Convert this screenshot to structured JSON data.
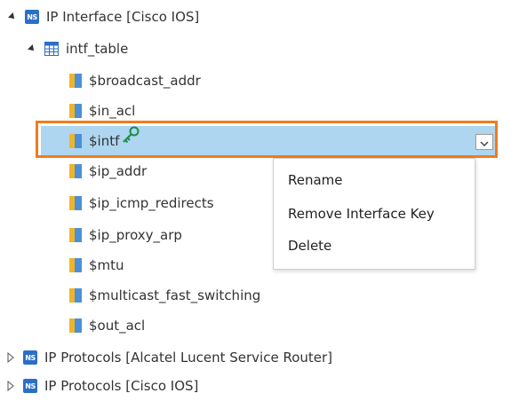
{
  "tree": {
    "root": {
      "label": "IP Interface [Cisco IOS]",
      "badge": "NS"
    },
    "table": {
      "label": "intf_table"
    },
    "vars": [
      "$broadcast_addr",
      "$in_acl",
      "$intf",
      "$ip_addr",
      "$ip_icmp_redirects",
      "$ip_proxy_arp",
      "$mtu",
      "$multicast_fast_switching",
      "$out_acl"
    ],
    "collapsed": [
      {
        "label": "IP Protocols [Alcatel Lucent Service Router]",
        "badge": "NS"
      },
      {
        "label": "IP Protocols [Cisco IOS]",
        "badge": "NS"
      }
    ]
  },
  "context_menu": {
    "items": [
      "Rename",
      "Remove Interface Key",
      "Delete"
    ]
  },
  "colors": {
    "selection": "#aed6f1",
    "highlight_border": "#f07c1a",
    "ns_badge": "#2b6fc7",
    "key_icon": "#1e8c4a"
  }
}
